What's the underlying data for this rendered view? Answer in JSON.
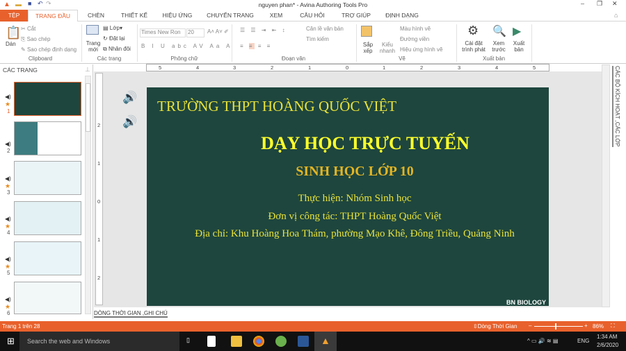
{
  "window": {
    "title": "nguyen phan* - Avina Authoring Tools Pro"
  },
  "tabs": [
    "TỆP",
    "TRANG ĐẦU",
    "CHÈN",
    "THIẾT KẾ",
    "HIỆU ỨNG",
    "CHUYỂN TRANG",
    "XEM",
    "CÂU HỎI",
    "TRỢ GIÚP",
    "ĐỊNH DẠNG"
  ],
  "ribbon": {
    "clipboard": {
      "paste": "Dán",
      "cut": "Cắt",
      "copy": "Sao chép",
      "format_painter": "Sao chép định dạng",
      "label": "Clipboard"
    },
    "pages": {
      "new_page": "Trang mới",
      "layer": "Lớp",
      "reset": "Đặt lại",
      "duplicate": "Nhân đôi",
      "label": "Các trang"
    },
    "font": {
      "font_name": "Times New Ron",
      "font_size": "20",
      "label": "Phông chữ"
    },
    "paragraph": {
      "align_text": "Căn lề văn bản",
      "find": "Tìm kiếm",
      "label": "Đoạn văn"
    },
    "drawing": {
      "arrange": "Sắp xếp",
      "quick_styles": "Kiểu nhanh",
      "shape_fill": "Màu hình vẽ",
      "outline": "Đường viền",
      "shape_effects": "Hiệu ứng hình vẽ",
      "label": "Vẽ"
    },
    "publish": {
      "player_settings": "Cài đặt trình phát",
      "preview": "Xem trước",
      "publish": "Xuất bản",
      "label": "Xuất bản"
    }
  },
  "ruler": [
    "5",
    "4",
    "3",
    "2",
    "1",
    "0",
    "1",
    "2",
    "3",
    "4",
    "5"
  ],
  "vruler": [
    "2",
    "1",
    "0",
    "1",
    "2"
  ],
  "pages_panel": {
    "title": "CÁC TRANG",
    "pages": [
      {
        "n": "1",
        "star": true
      },
      {
        "n": "2",
        "star": false
      },
      {
        "n": "3",
        "star": true
      },
      {
        "n": "4",
        "star": true
      },
      {
        "n": "5",
        "star": true
      },
      {
        "n": "6",
        "star": true
      }
    ]
  },
  "slide": {
    "school": "TRƯỜNG THPT HOÀNG QUỐC VIỆT",
    "title": "DẠY HỌC TRỰC TUYẾN",
    "subtitle": "SINH HỌC LỚP 10",
    "line1": "Thực hiện: Nhóm Sinh học",
    "line2": "Đơn vị công tác: THPT Hoàng Quốc Việt",
    "line3": "Địa chỉ: Khu Hoàng Hoa Thám, phường Mạo Khê, Đông Triều, Quảng Ninh",
    "watermark": "BN BIOLOGY",
    "bg": "#1e463e"
  },
  "right_panel": {
    "title": "CÁC BỘ KÍCH HOẠT ,CÁC LỚP"
  },
  "notes_tab": "DÒNG THỜI GIAN ,GHI CHÚ",
  "status": {
    "page": "Trang 1 trên 28",
    "timeline": "Dòng Thời Gian",
    "zoom": "86%",
    "zoom_value": 86
  },
  "taskbar": {
    "search": "Search the web and Windows",
    "lang": "ENG",
    "time": "1:34 AM",
    "date": "2/6/2020"
  },
  "colors": {
    "accent": "#e8612c",
    "slide_text": "#e8e23a"
  }
}
